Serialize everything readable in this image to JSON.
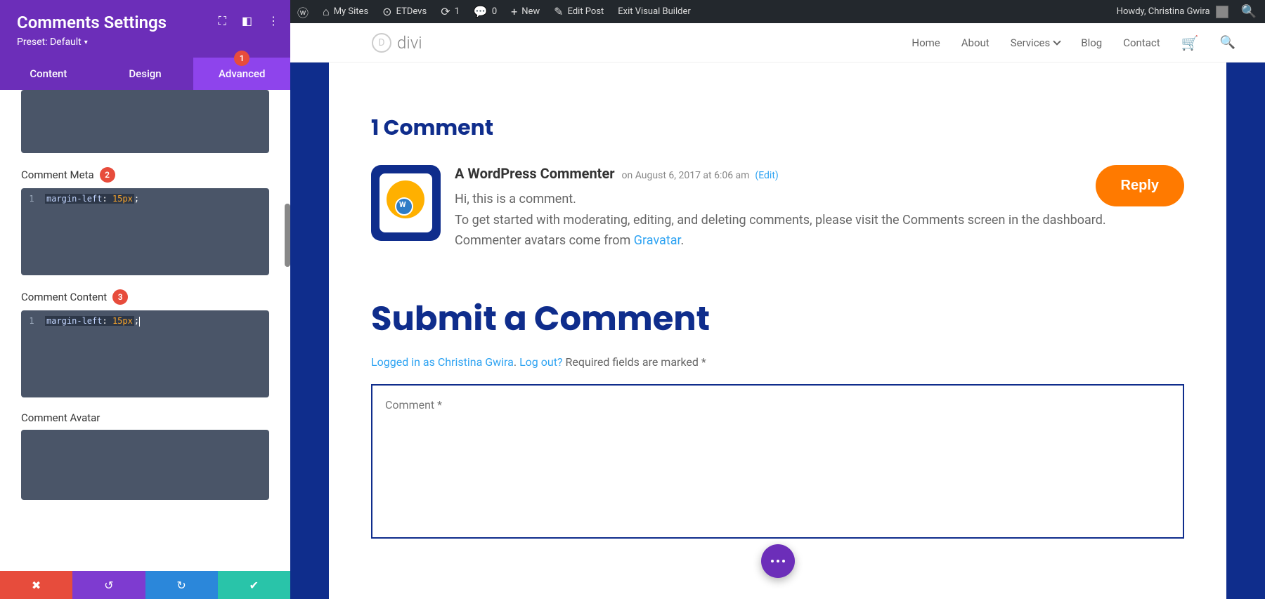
{
  "panel": {
    "title": "Comments Settings",
    "preset": "Preset: Default",
    "tabs": {
      "content": "Content",
      "design": "Design",
      "advanced": "Advanced",
      "advanced_badge": "1"
    },
    "fields": {
      "meta_label": "Comment Meta",
      "meta_badge": "2",
      "content_label": "Comment Content",
      "content_badge": "3",
      "avatar_label": "Comment Avatar"
    },
    "code": {
      "line_num": "1",
      "prop": "margin-left",
      "sep": ": ",
      "val": "15px",
      "end": ";"
    }
  },
  "wpbar": {
    "my_sites": "My Sites",
    "etdevs": "ETDevs",
    "updates": "1",
    "comments": "0",
    "new": "New",
    "edit_post": "Edit Post",
    "exit_vb": "Exit Visual Builder",
    "howdy": "Howdy, Christina Gwira"
  },
  "site": {
    "logo_text": "divi",
    "logo_letter": "D",
    "nav": {
      "home": "Home",
      "about": "About",
      "services": "Services",
      "blog": "Blog",
      "contact": "Contact"
    }
  },
  "comments": {
    "title": "1 Comment",
    "author": "A WordPress Commenter",
    "meta": "on August 6, 2017 at 6:06 am",
    "edit": "(Edit)",
    "line1": "Hi, this is a comment.",
    "line2": "To get started with moderating, editing, and deleting comments, please visit the Comments screen in the dashboard.",
    "line3a": "Commenter avatars come from ",
    "gravatar": "Gravatar",
    "line3b": ".",
    "reply": "Reply"
  },
  "form": {
    "title": "Submit a Comment",
    "logged_in": "Logged in as Christina Gwira",
    "logout": "Log out?",
    "required": "Required fields are marked *",
    "placeholder": "Comment *",
    "dot": ". ",
    "space": " "
  }
}
